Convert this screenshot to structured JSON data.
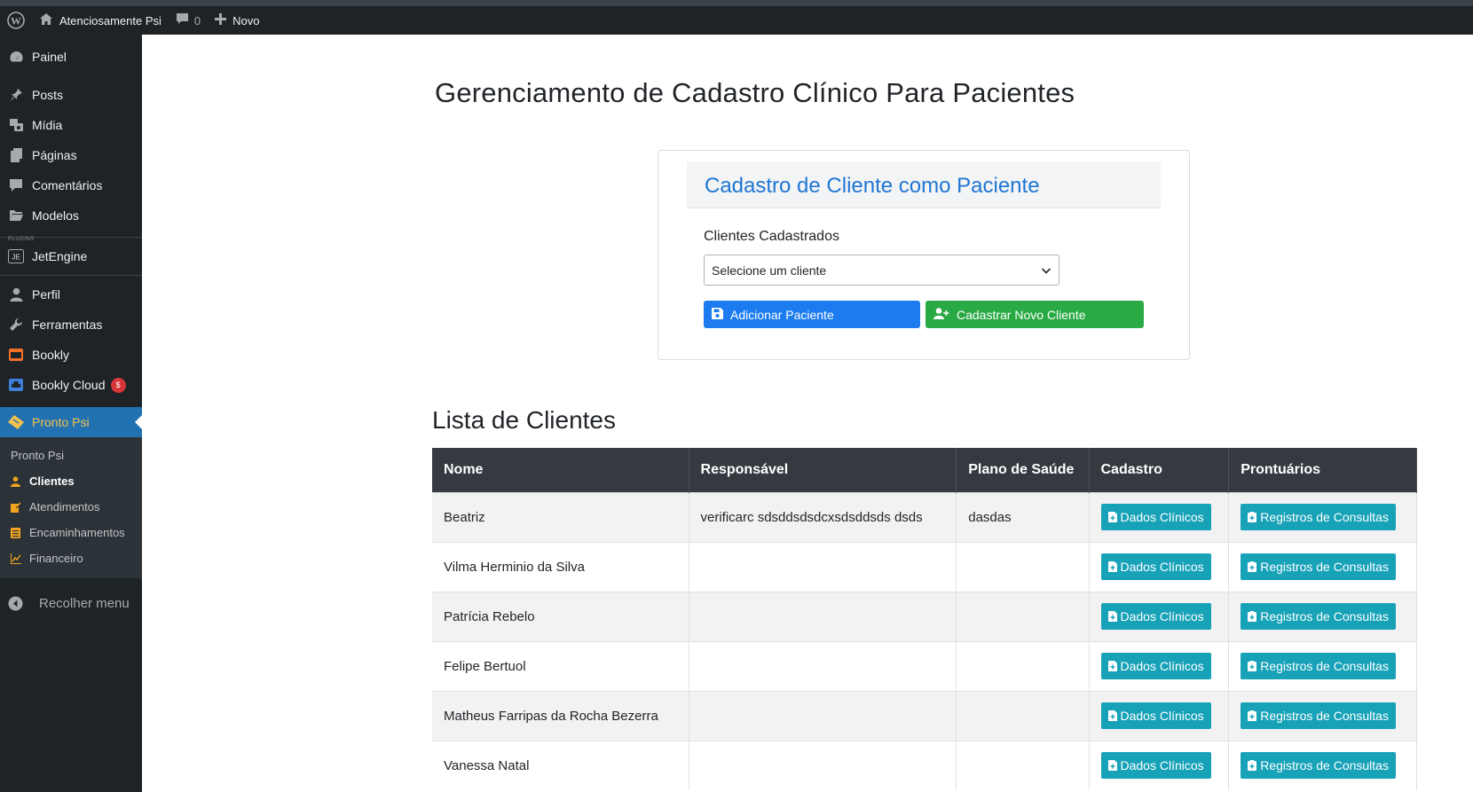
{
  "adminbar": {
    "site_name": "Atenciosamente Psi",
    "comments_count": "0",
    "new_label": "Novo"
  },
  "sidebar": {
    "items": [
      {
        "label": "Painel",
        "icon": "dashboard-icon"
      },
      {
        "label": "Posts",
        "icon": "pin-icon"
      },
      {
        "label": "Mídia",
        "icon": "media-icon"
      },
      {
        "label": "Páginas",
        "icon": "pages-icon"
      },
      {
        "label": "Comentários",
        "icon": "comment-icon"
      },
      {
        "label": "Modelos",
        "icon": "folder-icon"
      },
      {
        "label": "JetEngine",
        "icon": "jetengine-icon"
      },
      {
        "label": "Perfil",
        "icon": "user-icon"
      },
      {
        "label": "Ferramentas",
        "icon": "wrench-icon"
      },
      {
        "label": "Bookly",
        "icon": "calendar-icon"
      },
      {
        "label": "Bookly Cloud",
        "icon": "cloud-icon",
        "badge": "$"
      },
      {
        "label": "Pronto Psi",
        "icon": "ticket-icon"
      }
    ],
    "plugins_tag": "PLUGINS",
    "submenu": [
      {
        "label": "Pronto Psi"
      },
      {
        "label": "Clientes",
        "icon": "user-icon"
      },
      {
        "label": "Atendimentos",
        "icon": "edit-icon"
      },
      {
        "label": "Encaminhamentos",
        "icon": "list-icon"
      },
      {
        "label": "Financeiro",
        "icon": "chart-icon"
      }
    ],
    "collapse_label": "Recolher menu"
  },
  "main": {
    "title": "Gerenciamento de Cadastro Clínico Para Pacientes",
    "card": {
      "title": "Cadastro de Cliente como Paciente",
      "label": "Clientes Cadastrados",
      "select_value": "Selecione um cliente",
      "add_button": "Adicionar Paciente",
      "new_button": "Cadastrar Novo Cliente"
    },
    "list_title": "Lista de Clientes",
    "table": {
      "headers": [
        "Nome",
        "Responsável",
        "Plano de Saúde",
        "Cadastro",
        "Prontuários"
      ],
      "rows": [
        {
          "name": "Beatriz",
          "responsavel": "verificarc sdsddsdsdcxsdsddsds dsds",
          "plano": "dasdas"
        },
        {
          "name": "Vilma Herminio da Silva",
          "responsavel": "",
          "plano": ""
        },
        {
          "name": "Patrícia Rebelo",
          "responsavel": "",
          "plano": ""
        },
        {
          "name": "Felipe Bertuol",
          "responsavel": "",
          "plano": ""
        },
        {
          "name": "Matheus Farripas da Rocha Bezerra",
          "responsavel": "",
          "plano": ""
        },
        {
          "name": "Vanessa Natal",
          "responsavel": "",
          "plano": ""
        }
      ],
      "btn_dados": "Dados Clínicos",
      "btn_registros": "Registros de Consultas"
    }
  },
  "colors": {
    "sidebar_bg": "#1d2327",
    "active_bg": "#2271b1",
    "primary": "#1c7cef",
    "success": "#2aaa44",
    "info": "#17a2b8",
    "table_header": "#343a40"
  }
}
